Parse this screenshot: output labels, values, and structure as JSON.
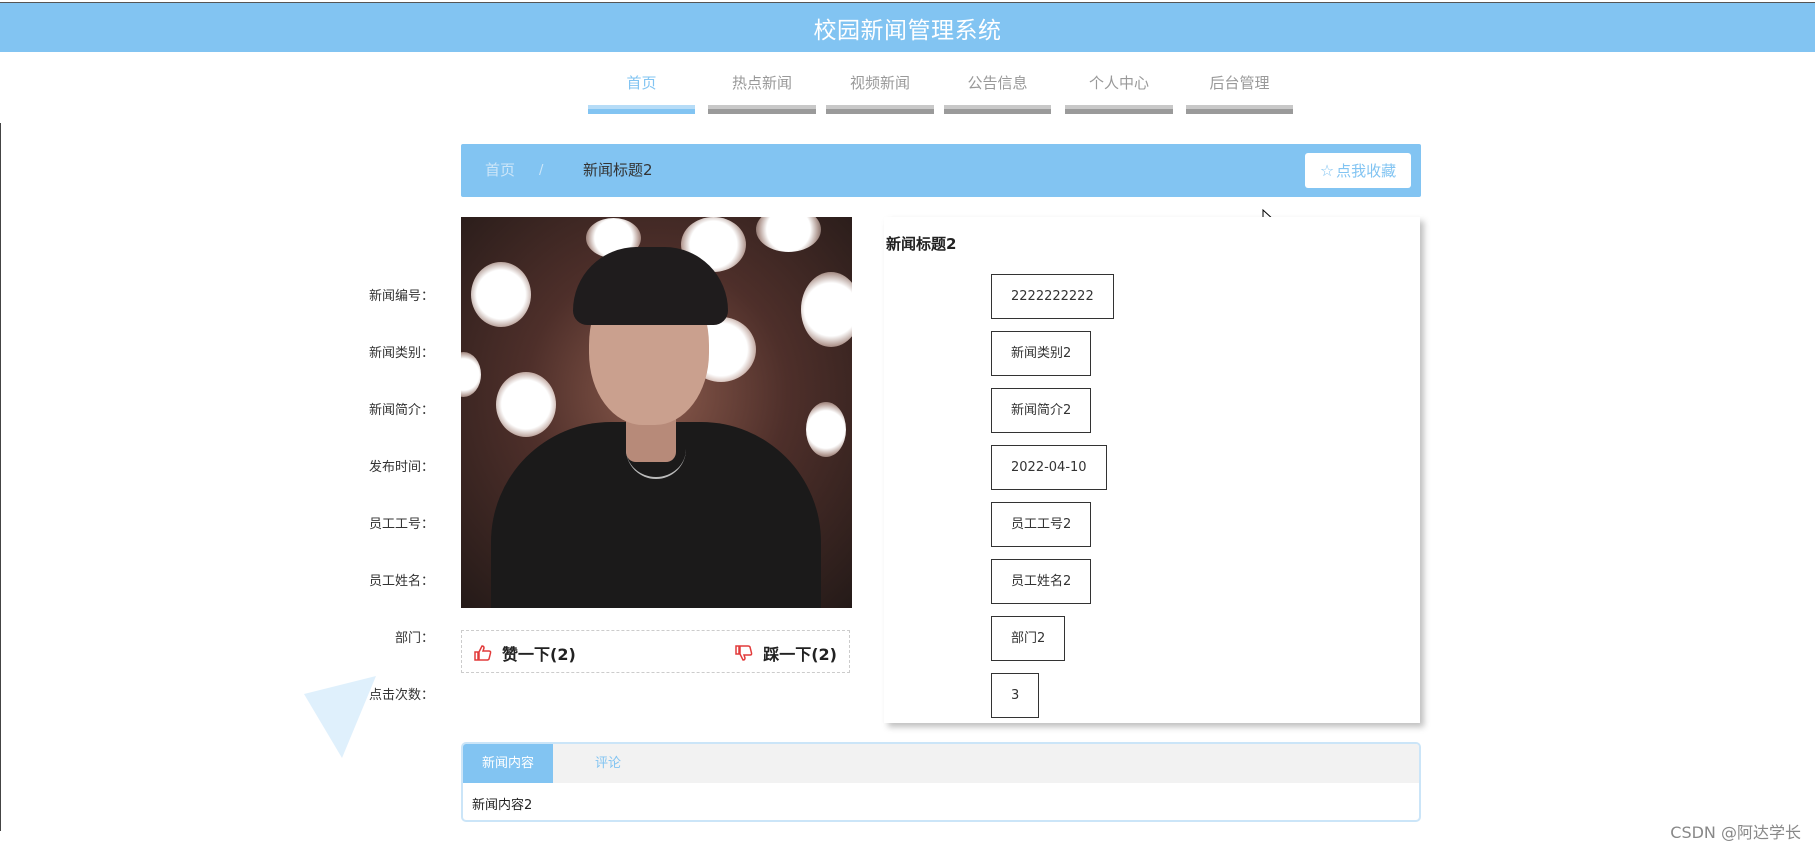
{
  "header": {
    "title": "校园新闻管理系统"
  },
  "nav": {
    "items": [
      {
        "label": "首页",
        "active": true
      },
      {
        "label": "热点新闻",
        "active": false
      },
      {
        "label": "视频新闻",
        "active": false
      },
      {
        "label": "公告信息",
        "active": false
      },
      {
        "label": "个人中心",
        "active": false
      },
      {
        "label": "后台管理",
        "active": false
      }
    ]
  },
  "breadcrumb": {
    "home": "首页",
    "separator": "/",
    "current": "新闻标题2"
  },
  "favorite_button": {
    "icon": "star-outline-icon",
    "label": "点我收藏"
  },
  "votes": {
    "like": {
      "icon": "thumbs-up-icon",
      "label": "赞一下(2)"
    },
    "dislike": {
      "icon": "thumbs-down-icon",
      "label": "踩一下(2)"
    }
  },
  "detail": {
    "title": "新闻标题2",
    "fields": [
      {
        "label": "新闻编号：",
        "value": "2222222222"
      },
      {
        "label": "新闻类别：",
        "value": "新闻类别2"
      },
      {
        "label": "新闻简介：",
        "value": "新闻简介2"
      },
      {
        "label": "发布时间：",
        "value": "2022-04-10"
      },
      {
        "label": "员工工号：",
        "value": "员工工号2"
      },
      {
        "label": "员工姓名：",
        "value": "员工姓名2"
      },
      {
        "label": "部门：",
        "value": "部门2"
      },
      {
        "label": "点击次数：",
        "value": "3"
      }
    ]
  },
  "tabs": {
    "items": [
      {
        "label": "新闻内容",
        "active": true
      },
      {
        "label": "评论",
        "active": false
      }
    ],
    "content": "新闻内容2"
  },
  "colors": {
    "accent": "#82c4f2",
    "like": "#e23b3b"
  },
  "watermark": "CSDN @阿达学长"
}
